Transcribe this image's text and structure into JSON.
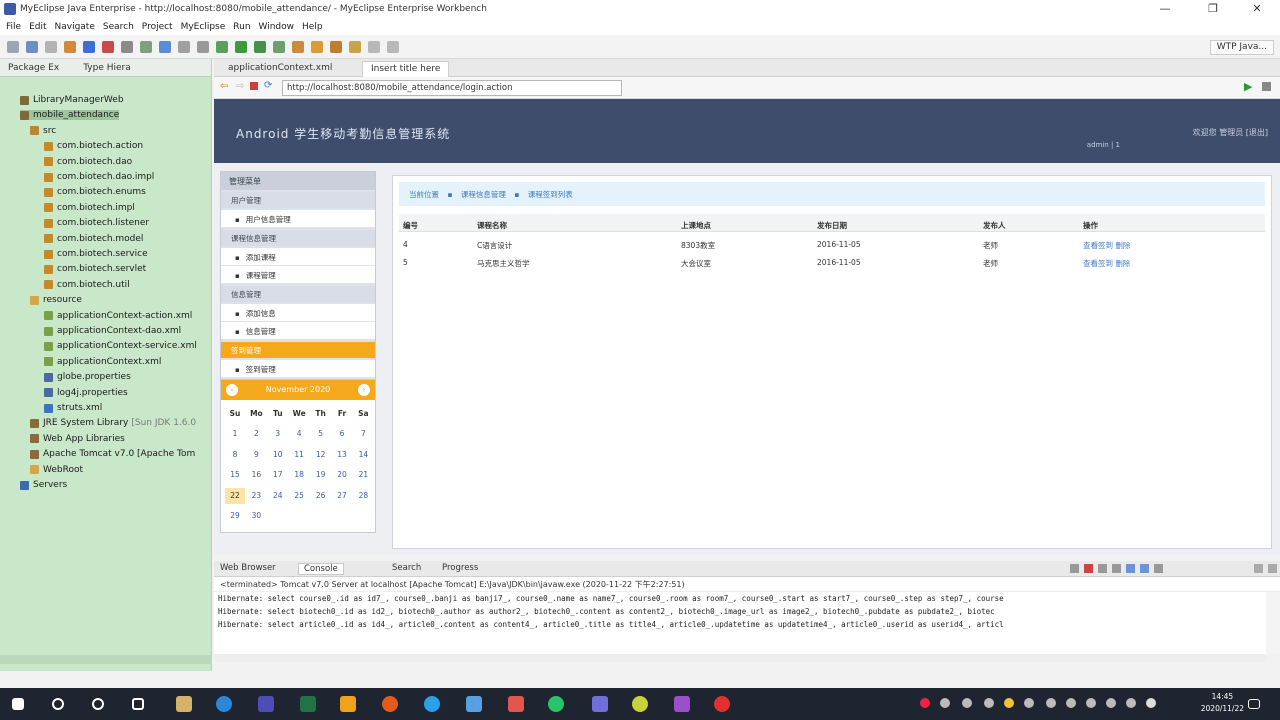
{
  "window": {
    "title": "MyEclipse Java Enterprise - http://localhost:8080/mobile_attendance/ - MyEclipse Enterprise Workbench",
    "controls": [
      "—",
      "❐",
      "✕"
    ]
  },
  "menubar": [
    "File",
    "Edit",
    "Navigate",
    "Search",
    "Project",
    "MyEclipse",
    "Run",
    "Window",
    "Help"
  ],
  "perspective": "WTP Java...",
  "left_pane": {
    "tabs": [
      "Package Ex",
      "Type Hiera"
    ],
    "tree": [
      {
        "label": "LibraryManagerWeb",
        "icon": "project-icon"
      },
      {
        "label": "mobile_attendance",
        "icon": "project-icon",
        "selected": true
      },
      {
        "label": "src",
        "icon": "src-folder-icon"
      },
      {
        "label": "com.biotech.action",
        "icon": "package-icon"
      },
      {
        "label": "com.biotech.dao",
        "icon": "package-icon"
      },
      {
        "label": "com.biotech.dao.impl",
        "icon": "package-icon"
      },
      {
        "label": "com.biotech.enums",
        "icon": "package-icon"
      },
      {
        "label": "com.biotech.impl",
        "icon": "package-icon"
      },
      {
        "label": "com.biotech.listener",
        "icon": "package-icon"
      },
      {
        "label": "com.biotech.model",
        "icon": "package-icon"
      },
      {
        "label": "com.biotech.service",
        "icon": "package-icon"
      },
      {
        "label": "com.biotech.servlet",
        "icon": "package-icon"
      },
      {
        "label": "com.biotech.util",
        "icon": "package-icon"
      },
      {
        "label": "resource",
        "icon": "folder-icon"
      },
      {
        "label": "applicationContext-action.xml",
        "icon": "xml-icon"
      },
      {
        "label": "applicationContext-dao.xml",
        "icon": "xml-icon"
      },
      {
        "label": "applicationContext-service.xml",
        "icon": "xml-icon"
      },
      {
        "label": "applicationContext.xml",
        "icon": "xml-icon"
      },
      {
        "label": "globe.properties",
        "icon": "properties-icon"
      },
      {
        "label": "log4j.properties",
        "icon": "properties-icon"
      },
      {
        "label": "struts.xml",
        "icon": "struts-icon"
      },
      {
        "label": "JRE System Library",
        "suffix": "[Sun JDK 1.6.0",
        "icon": "library-icon"
      },
      {
        "label": "Web App Libraries",
        "icon": "library-icon"
      },
      {
        "label": "Apache Tomcat v7.0 [Apache Tom",
        "icon": "library-icon"
      },
      {
        "label": "WebRoot",
        "icon": "folder-icon"
      },
      {
        "label": "Servers",
        "icon": "servers-icon"
      }
    ]
  },
  "editor": {
    "tabs": [
      "applicationContext.xml",
      "Insert title here"
    ],
    "url": "http://localhost:8080/mobile_attendance/login.action"
  },
  "webapp": {
    "title": "Android 学生移动考勤信息管理系统",
    "header_links": "欢迎您   管理员   [退出]",
    "header_user": "admin | 1",
    "side_menu": {
      "head": "管理菜单",
      "groups": [
        {
          "label": "用户管理",
          "items": [
            "用户信息管理"
          ]
        },
        {
          "label": "课程信息管理",
          "items": [
            "添加课程",
            "课程管理"
          ]
        },
        {
          "label": "信息管理",
          "items": [
            "添加信息",
            "信息管理"
          ]
        },
        {
          "label": "签到管理",
          "active": true,
          "items": [
            "签到管理"
          ]
        }
      ]
    },
    "calendar": {
      "month": "November 2020",
      "weekdays": [
        "Su",
        "Mo",
        "Tu",
        "We",
        "Th",
        "Fr",
        "Sa"
      ],
      "weeks": [
        [
          "1",
          "2",
          "3",
          "4",
          "5",
          "6",
          "7"
        ],
        [
          "8",
          "9",
          "10",
          "11",
          "12",
          "13",
          "14"
        ],
        [
          "15",
          "16",
          "17",
          "18",
          "19",
          "20",
          "21"
        ],
        [
          "22",
          "23",
          "24",
          "25",
          "26",
          "27",
          "28"
        ],
        [
          "29",
          "30",
          "",
          "",
          "",
          "",
          ""
        ]
      ],
      "today": "22"
    },
    "breadcrumb": [
      "当前位置",
      "课程信息管理",
      "课程签到列表"
    ],
    "table": {
      "headers": [
        "编号",
        "课程名称",
        "上课地点",
        "发布日期",
        "发布人",
        "操作"
      ],
      "rows": [
        [
          "4",
          "C语言设计",
          "8303教室",
          "2016-11-05",
          "老师",
          "查看签到 删除"
        ],
        [
          "5",
          "马克思主义哲学",
          "大会议室",
          "2016-11-05",
          "老师",
          "查看签到 删除"
        ]
      ]
    }
  },
  "console": {
    "tabs": [
      "Web Browser",
      "Console",
      "Search",
      "Progress"
    ],
    "status": "<terminated> Tomcat v7.0 Server at localhost [Apache Tomcat] E:\\Java\\JDK\\bin\\javaw.exe (2020-11-22 下午2:27:51)",
    "lines": [
      "Hibernate: select course0_.id as id7_, course0_.banji as banji7_, course0_.name as name7_, course0_.room as room7_, course0_.start as start7_, course0_.step as step7_, course",
      "Hibernate: select biotech0_.id as id2_, biotech0_.author as author2_, biotech0_.content as content2_, biotech0_.image_url as image2_, biotech0_.pubdate as pubdate2_, biotec",
      "Hibernate: select article0_.id as id4_, article0_.content as content4_, article0_.title as title4_, article0_.updatetime as updatetime4_, article0_.userid as userid4_, articl"
    ]
  },
  "taskbar": {
    "clock_time": "14:45",
    "clock_date": "2020/11/22"
  },
  "colors": {
    "header_bg": "#3f4d6c",
    "accent_orange": "#f4a81c",
    "left_pane_bg": "#c9e7c9",
    "link_blue": "#3f7bc2"
  }
}
